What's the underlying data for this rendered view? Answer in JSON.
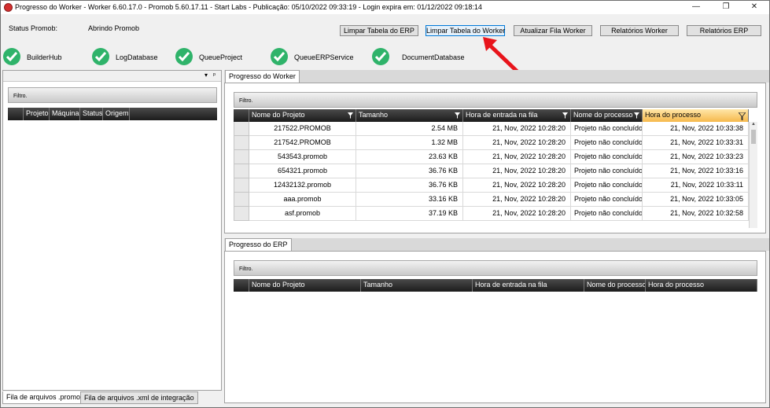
{
  "window": {
    "title": "Progresso do Worker  -  Worker 6.60.17.0 - Promob 5.60.17.11  -  Start Labs  -  Publicação: 05/10/2022 09:33:19  -  Login expira em: 01/12/2022 09:18:14",
    "minimize": "—",
    "maximize": "❐",
    "close": "✕"
  },
  "status": {
    "label": "Status Promob:",
    "value": "Abrindo Promob"
  },
  "buttons": {
    "clear_erp": "Limpar Tabela do ERP",
    "clear_worker": "Limpar Tabela do Worker",
    "update_queue": "Atualizar Fila Worker",
    "reports_worker": "Relatórios Worker",
    "reports_erp": "Relatórios ERP"
  },
  "services": [
    {
      "name": "BuilderHub",
      "status": "ok"
    },
    {
      "name": "LogDatabase",
      "status": "ok"
    },
    {
      "name": "QueueProject",
      "status": "ok"
    },
    {
      "name": "QueueERPService",
      "status": "ok"
    },
    {
      "name": "DocumentDatabase",
      "status": "ok"
    }
  ],
  "left_panel": {
    "dropdown": "▾",
    "pin": "ᵖ",
    "filter": "Filtro.",
    "columns": [
      "Projeto",
      "Máquina",
      "Status",
      "Origem"
    ],
    "tabs": [
      "Fila de arquivos .promob",
      "Fila de arquivos .xml de integração"
    ]
  },
  "worker_panel": {
    "tab": "Progresso do Worker",
    "filter": "Filtro.",
    "columns": [
      "Nome do Projeto",
      "Tamanho",
      "Hora de entrada na fila",
      "Nome do processo",
      "Hora do processo"
    ],
    "rows": [
      [
        "217522.PROMOB",
        "2.54 MB",
        "21, Nov, 2022 10:28:20",
        "Projeto não concluído",
        "21, Nov, 2022 10:33:38"
      ],
      [
        "217542.PROMOB",
        "1.32 MB",
        "21, Nov, 2022 10:28:20",
        "Projeto não concluído",
        "21, Nov, 2022 10:33:31"
      ],
      [
        "543543.promob",
        "23.63 KB",
        "21, Nov, 2022 10:28:20",
        "Projeto não concluído",
        "21, Nov, 2022 10:33:23"
      ],
      [
        "654321.promob",
        "36.76 KB",
        "21, Nov, 2022 10:28:20",
        "Projeto não concluído",
        "21, Nov, 2022 10:33:16"
      ],
      [
        "12432132.promob",
        "36.76 KB",
        "21, Nov, 2022 10:28:20",
        "Projeto não concluído",
        "21, Nov, 2022 10:33:11"
      ],
      [
        "aaa.promob",
        "33.16 KB",
        "21, Nov, 2022 10:28:20",
        "Projeto não concluído",
        "21, Nov, 2022 10:33:05"
      ],
      [
        "asf.promob",
        "37.19 KB",
        "21, Nov, 2022 10:28:20",
        "Projeto não concluído",
        "21, Nov, 2022 10:32:58"
      ]
    ]
  },
  "erp_panel": {
    "tab": "Progresso do ERP",
    "filter": "Filtro.",
    "columns": [
      "Nome do Projeto",
      "Tamanho",
      "Hora de entrada na fila",
      "Nome do processo",
      "Hora do processo"
    ]
  },
  "colors": {
    "accent_green": "#2fb36a",
    "sorted_header": "#f6b94c",
    "annotation_red": "#e8141b"
  }
}
